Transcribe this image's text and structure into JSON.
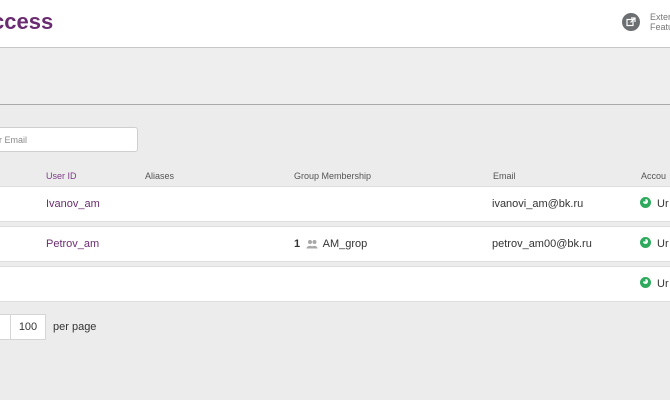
{
  "header": {
    "title": "ccess",
    "external_line1": "Exter",
    "external_line2": "Featu",
    "external_icon": "external-link-icon"
  },
  "search": {
    "placeholder": "r Email"
  },
  "columns": {
    "user_id": "User ID",
    "aliases": "Aliases",
    "group_membership": "Group Membership",
    "email": "Email",
    "account": "Accou"
  },
  "rows": [
    {
      "user_id": "Ivanov_am",
      "aliases": "",
      "group_count": "",
      "group_name": "",
      "email": "ivanovi_am@bk.ru",
      "status": "Ur"
    },
    {
      "user_id": "Petrov_am",
      "aliases": "",
      "group_count": "1",
      "group_name": "AM_grop",
      "email": "petrov_am00@bk.ru",
      "status": "Ur"
    },
    {
      "user_id": "",
      "aliases": "",
      "group_count": "",
      "group_name": "",
      "email": "",
      "status": "Ur"
    }
  ],
  "pagination": {
    "page_size": "100",
    "per_page_label": "per page"
  },
  "colors": {
    "accent": "#6a2c70",
    "status_green": "#2eaa5c"
  }
}
